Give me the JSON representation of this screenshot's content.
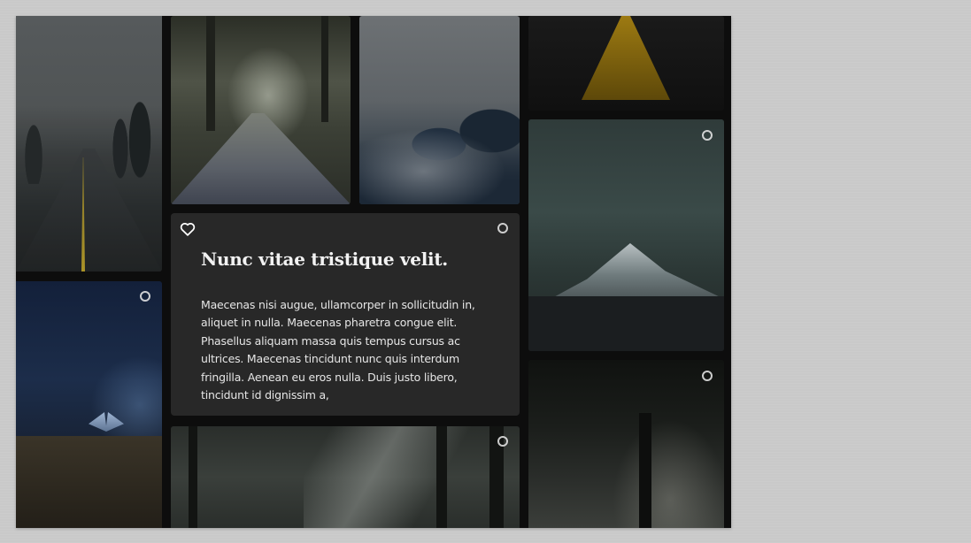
{
  "card": {
    "title": "Nunc vitae tristique velit.",
    "body": "Maecenas nisi augue, ullamcorper in sollicitudin in, aliquet in nulla. Maecenas pharetra congue elit. Phasellus aliquam massa quis tempus cursus ac ultrices. Maecenas tincidunt nunc quis interdum fringilla. Aenean eu eros nulla. Duis justo libero, tincidunt id dignissim a,"
  },
  "icons": {
    "favorite": "heart-outline-icon",
    "select": "circle-outline-icon"
  },
  "colors": {
    "page_background": "#c9c9c9",
    "board_background": "#0d0d0d",
    "card_background": "#282828",
    "text": "#f2f2f2"
  }
}
